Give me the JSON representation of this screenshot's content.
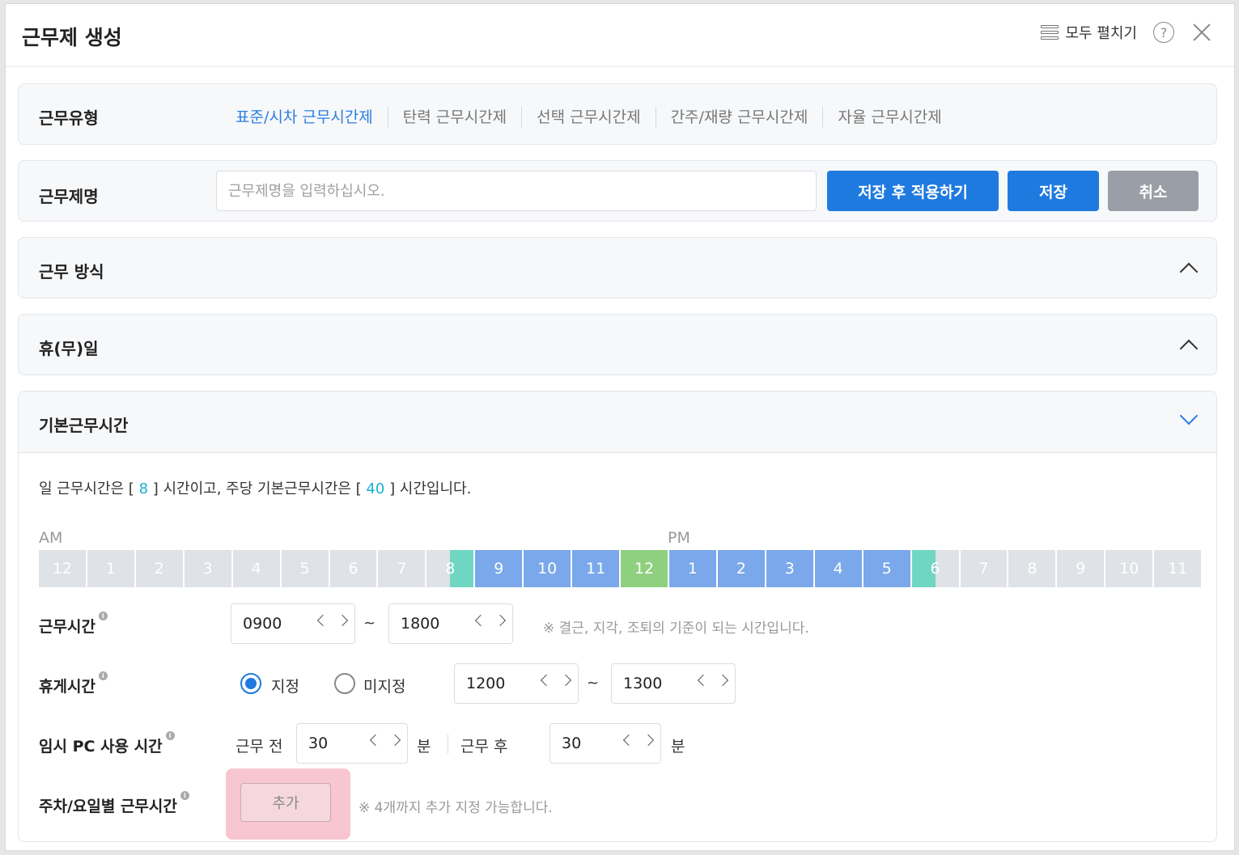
{
  "dialog": {
    "title": "근무제 생성",
    "expand_all": "모두 펼치기"
  },
  "work_type": {
    "label": "근무유형",
    "tabs": [
      {
        "label": "표준/시차 근무시간제",
        "active": true
      },
      {
        "label": "탄력 근무시간제",
        "active": false
      },
      {
        "label": "선택 근무시간제",
        "active": false
      },
      {
        "label": "간주/재량 근무시간제",
        "active": false
      },
      {
        "label": "자율 근무시간제",
        "active": false
      }
    ]
  },
  "work_name": {
    "label": "근무제명",
    "placeholder": "근무제명을 입력하십시오.",
    "save_apply": "저장 후 적용하기",
    "save": "저장",
    "cancel": "취소"
  },
  "sections": {
    "work_method": "근무 방식",
    "holiday": "휴(무)일",
    "basic_hours": "기본근무시간"
  },
  "summary": {
    "prefix": "일 근무시간은 [",
    "daily": "8",
    "middle": "] 시간이고, 주당 기본근무시간은 [",
    "weekly": "40",
    "suffix": "] 시간입니다."
  },
  "timeline": {
    "am_label": "AM",
    "pm_label": "PM",
    "hours": [
      "12",
      "1",
      "2",
      "3",
      "4",
      "5",
      "6",
      "7",
      "8",
      "9",
      "10",
      "11",
      "12",
      "1",
      "2",
      "3",
      "4",
      "5",
      "6",
      "7",
      "8",
      "9",
      "10",
      "11"
    ],
    "work_start": "0900",
    "work_end": "1800",
    "break_start": "1200",
    "break_end": "1300"
  },
  "work_time": {
    "label": "근무시간",
    "start": "0900",
    "end": "1800",
    "tilde": "~",
    "note": "※ 결근, 지각, 조퇴의 기준이 되는 시간입니다."
  },
  "break_time": {
    "label": "휴게시간",
    "opt_set": "지정",
    "opt_unset": "미지정",
    "selected": "지정",
    "start": "1200",
    "end": "1300",
    "tilde": "~"
  },
  "temp_pc": {
    "label": "임시 PC 사용 시간",
    "before_label": "근무 전",
    "before_value": "30",
    "after_label": "근무 후",
    "after_value": "30",
    "unit": "분"
  },
  "weekly_hours": {
    "label": "주차/요일별 근무시간",
    "add": "추가",
    "note": "※ 4개까지 추가 지정 가능합니다."
  },
  "colors": {
    "accent": "#1f7ae0",
    "work_cell": "#7aa8ea",
    "lunch_cell": "#8fd07f",
    "edge_cell": "#6fd6c3",
    "idle_cell": "#dfe2e6",
    "highlight": "#f8c6d0"
  }
}
